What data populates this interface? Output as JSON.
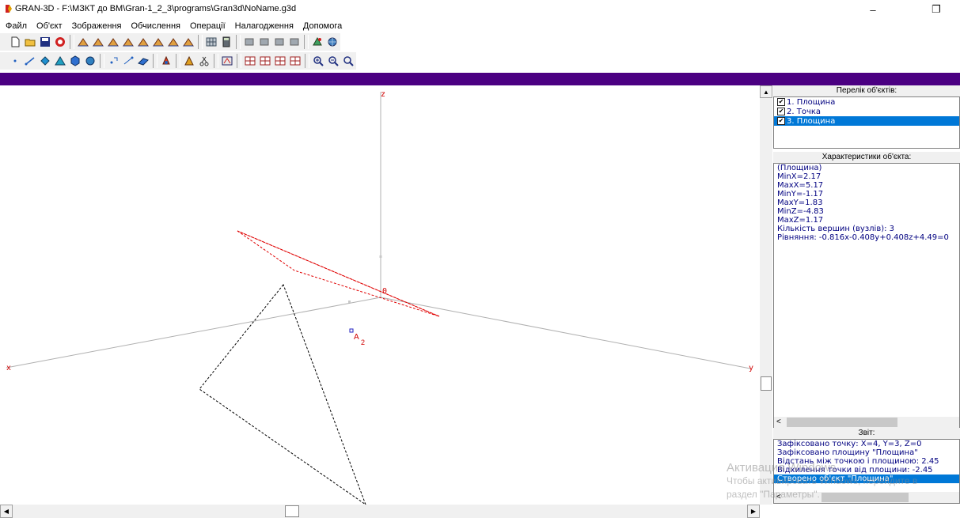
{
  "window": {
    "title": "GRAN-3D - F:\\МЗКТ до ВМ\\Gran-1_2_3\\programs\\Gran3d\\NoName.g3d",
    "minimize_glyph": "–",
    "restore_glyph": "❐"
  },
  "menu": [
    {
      "label": "Файл"
    },
    {
      "label": "Об'єкт"
    },
    {
      "label": "Зображення"
    },
    {
      "label": "Обчислення"
    },
    {
      "label": "Операції"
    },
    {
      "label": "Налагодження"
    },
    {
      "label": "Допомога"
    }
  ],
  "toolbar1": [
    "new-file-icon",
    "open-folder-icon",
    "save-icon",
    "stop-icon",
    "|",
    "surface-icon",
    "surface-icon",
    "surface-icon",
    "surface-icon",
    "surface-icon",
    "surface-icon",
    "surface-icon",
    "surface-icon",
    "|",
    "grid-icon",
    "calculator-icon",
    "|",
    "object-icon",
    "object-icon",
    "object-icon",
    "object-icon",
    "|",
    "render-icon",
    "globe-icon"
  ],
  "toolbar2": [
    "point-icon",
    "segment-icon",
    "polygon-icon",
    "pyramid-icon",
    "prism-icon",
    "sphere-icon",
    "|",
    "point-object-icon",
    "segment-object-icon",
    "plane-icon",
    "|",
    "paint-icon",
    "|",
    "modify-icon",
    "cut-icon",
    "|",
    "view-icon",
    "|",
    "projection-icon",
    "projection-icon",
    "projection-icon",
    "projection-icon",
    "|",
    "zoom-in-icon",
    "zoom-out-icon",
    "zoom-fit-icon"
  ],
  "canvas": {
    "axis_z": "z",
    "axis_x": "x",
    "axis_y": "y",
    "origin": "0",
    "point_label": "A",
    "point_index": "2",
    "colors": {
      "axis": "#b0b0b0",
      "plane_red": "#e00000",
      "plane_black": "#000000",
      "accent": "#4b0082"
    }
  },
  "panels": {
    "objects_header": "Перелік об'єктів:",
    "objects": [
      {
        "label": "1. Площина",
        "checked": true
      },
      {
        "label": "2. Точка",
        "checked": true
      },
      {
        "label": "3. Площина",
        "checked": true,
        "selected": true
      }
    ],
    "props_header": "Характеристики об'єкта:",
    "props": [
      "(Площина)",
      "MinX=2.17",
      "MaxX=5.17",
      "MinY=-1.17",
      "MaxY=1.83",
      "MinZ=-4.83",
      "MaxZ=1.17",
      "Кількість вершин (вузлів): 3",
      "Рівняння: -0.816x-0.408y+0.408z+4.49=0"
    ],
    "report_header": "Звіт:",
    "report": [
      {
        "text": "Зафіксовано точку: X=4, Y=3, Z=0"
      },
      {
        "text": "Зафіксовано площину \"Площина\""
      },
      {
        "text": "Відстань між точкою і площиною: 2.45"
      },
      {
        "text": "Відхилення точки від площини: -2.45"
      },
      {
        "text": "Створено об'єкт \"Площина\"",
        "selected": true
      }
    ]
  },
  "watermark": {
    "line1": "Активация Windows",
    "line2": "Чтобы активировать Windows, перейдите в",
    "line3": "раздел \"Параметры\"."
  }
}
